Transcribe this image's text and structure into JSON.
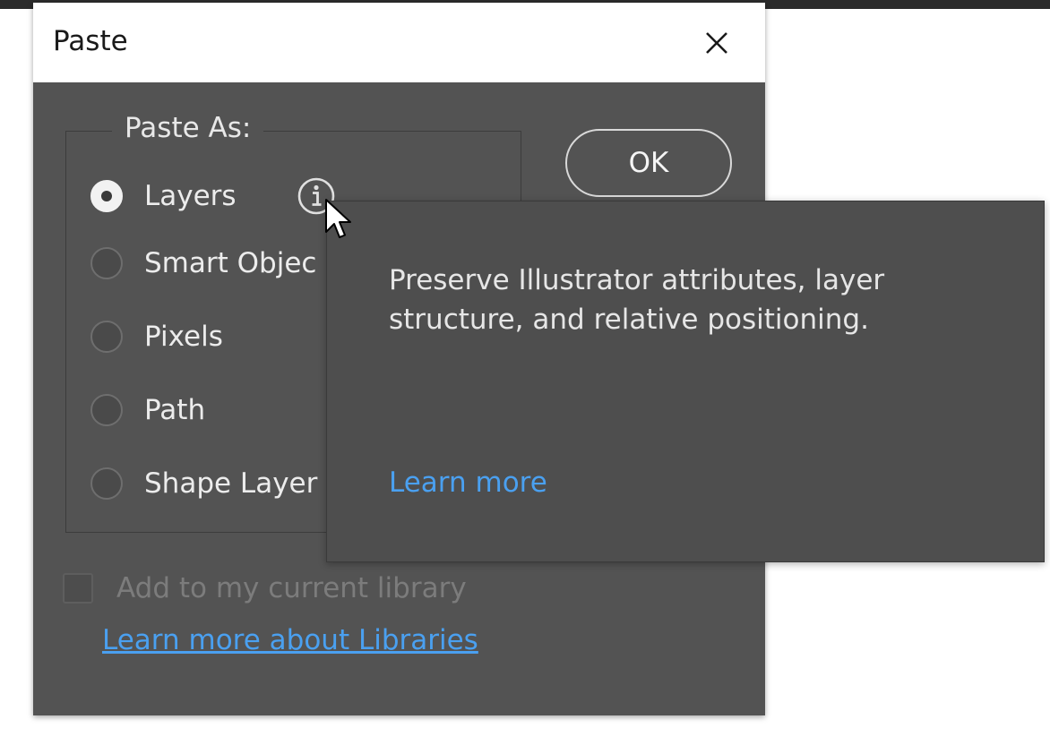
{
  "dialog": {
    "title": "Paste",
    "close_icon": "close-icon"
  },
  "paste_as": {
    "legend": "Paste As:",
    "options": [
      {
        "label": "Layers",
        "checked": true
      },
      {
        "label": "Smart Objec",
        "checked": false
      },
      {
        "label": "Pixels",
        "checked": false
      },
      {
        "label": "Path",
        "checked": false
      },
      {
        "label": "Shape Layer",
        "checked": false
      }
    ],
    "info_icon": "info-icon"
  },
  "ok_button": {
    "label": "OK"
  },
  "library": {
    "checkbox_label": "Add to my current library",
    "checked": false,
    "link": "Learn more about Libraries"
  },
  "tooltip": {
    "text": "Preserve Illustrator attributes, layer structure, and relative positioning.",
    "link": "Learn more"
  },
  "colors": {
    "dialog_bg": "#535353",
    "link": "#4aa0f0",
    "title_bg": "#ffffff"
  },
  "cursor_icon": "mouse-pointer-icon"
}
